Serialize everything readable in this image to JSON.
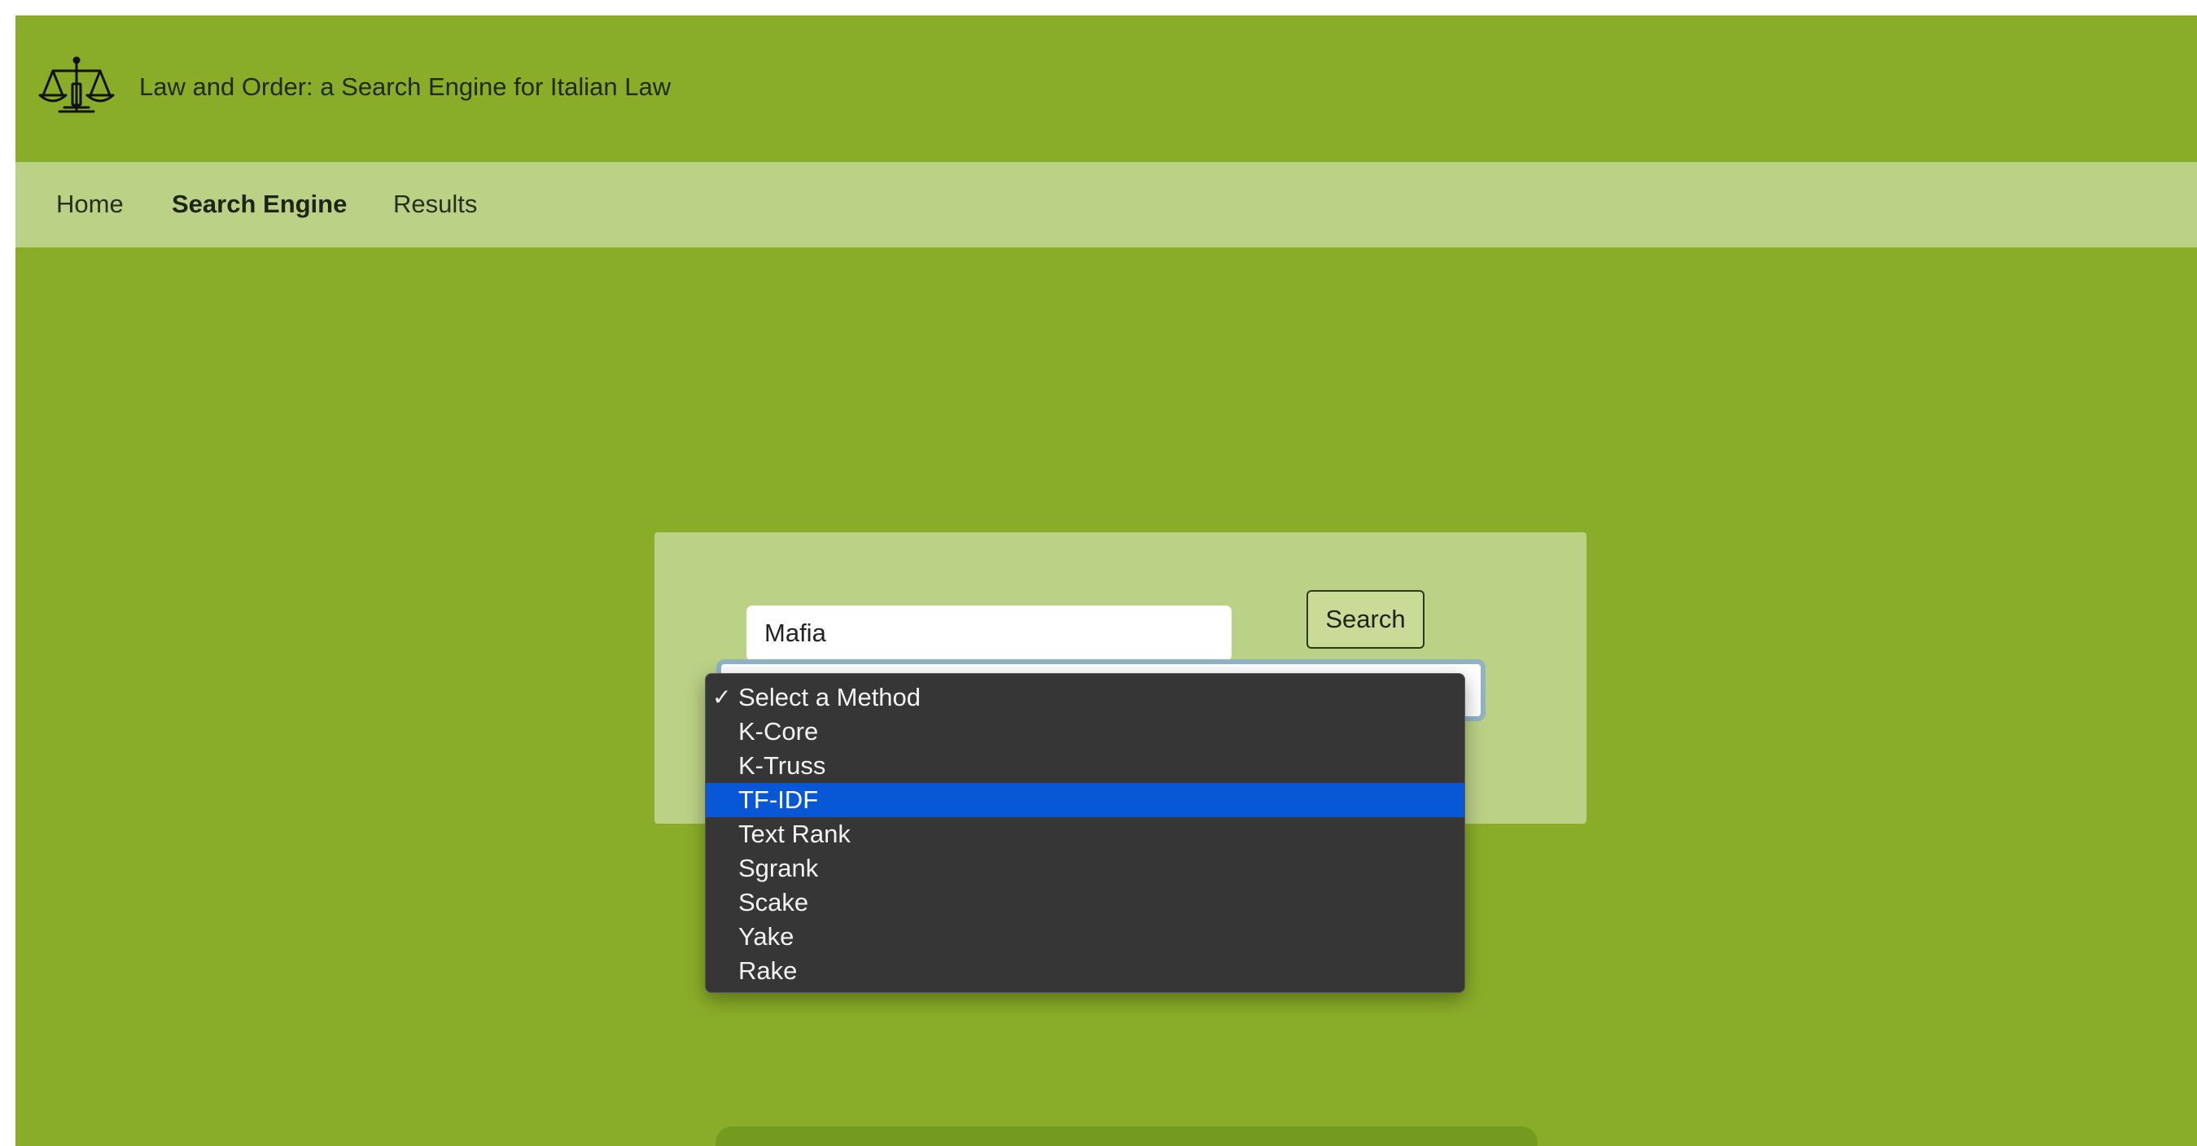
{
  "header": {
    "logo_icon": "scales-of-justice-icon",
    "title": "Law and Order: a Search Engine for Italian Law"
  },
  "nav": {
    "items": [
      {
        "label": "Home",
        "active": false
      },
      {
        "label": "Search Engine",
        "active": true
      },
      {
        "label": "Results",
        "active": false
      }
    ]
  },
  "search": {
    "query_value": "Mafia",
    "button_label": "Search"
  },
  "method_dropdown": {
    "checked_option": "Select a Method",
    "highlighted_option": "TF-IDF",
    "options": [
      "Select a Method",
      "K-Core",
      "K-Truss",
      "TF-IDF",
      "Text Rank",
      "Sgrank",
      "Scake",
      "Yake",
      "Rake"
    ]
  },
  "colors": {
    "background": "#8aad29",
    "navbar": "#bbd186",
    "card": "#bbd186",
    "dropdown_bg": "#363636",
    "highlight": "#0857d6"
  }
}
